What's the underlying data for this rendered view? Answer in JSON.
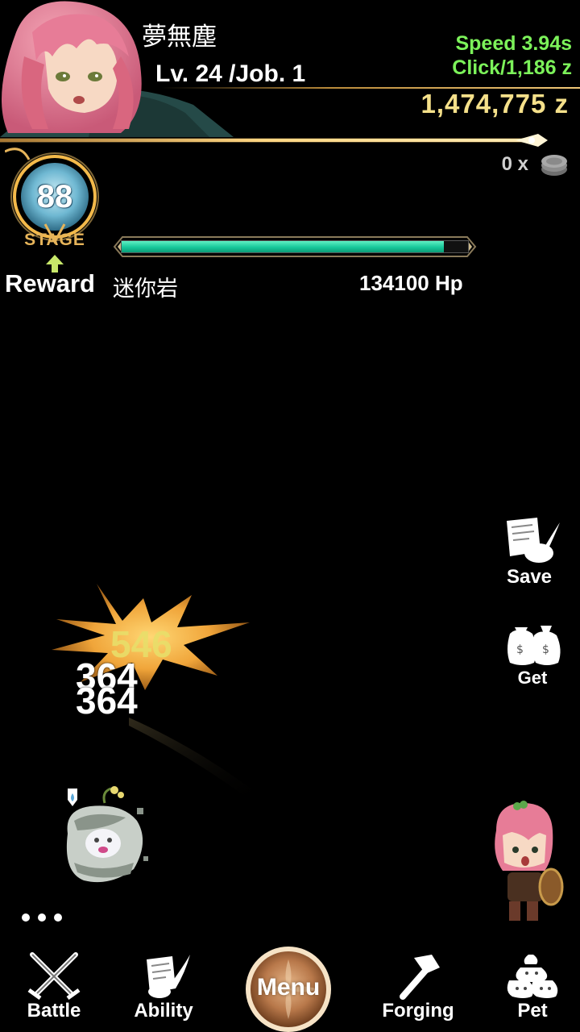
{
  "player": {
    "name": "夢無塵",
    "level": "Lv. 24 /Job. 1"
  },
  "stats": {
    "speed": "Speed 3.94s",
    "click": "Click/1,186 z",
    "gold": "1,474,775 z"
  },
  "coins": {
    "count": "0 x"
  },
  "stage": {
    "number": "88",
    "label": "STAGE",
    "reward_label": "Reward"
  },
  "monster": {
    "name": "迷你岩",
    "hp": "134100 Hp",
    "hp_fraction": 0.93
  },
  "side_buttons": {
    "save": "Save",
    "get": "Get"
  },
  "combat": {
    "crit_damage": "546",
    "hits": [
      "364",
      "364"
    ]
  },
  "nav": {
    "battle": "Battle",
    "ability": "Ability",
    "menu": "Menu",
    "forging": "Forging",
    "pet": "Pet"
  },
  "colors": {
    "stat_green": "#7cf25a",
    "gold_text": "#f5e08a",
    "hp_fill": "#17c79a",
    "accent_gold": "#e6b45a"
  },
  "icons": {
    "portrait": "player-portrait",
    "coin": "coin-stack-icon",
    "save": "scroll-quill-icon",
    "get": "money-bags-icon",
    "battle": "crossed-swords-icon",
    "ability": "scroll-quill-icon",
    "forging": "hammer-icon",
    "pet": "pet-sacks-icon"
  }
}
